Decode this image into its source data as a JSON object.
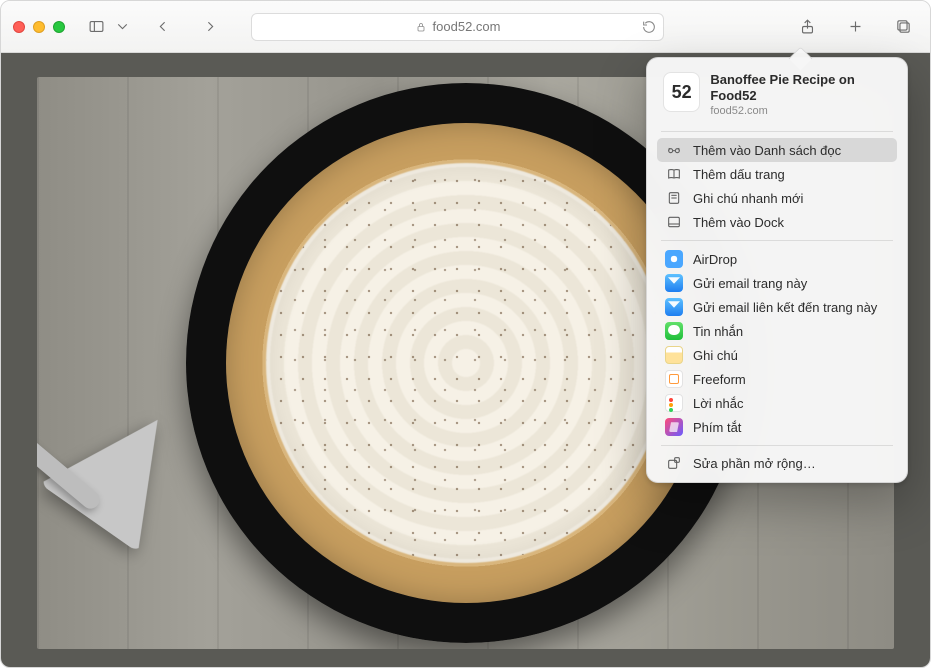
{
  "address_bar": {
    "domain": "food52.com"
  },
  "share_popover": {
    "favicon_text": "52",
    "title": "Banoffee Pie Recipe on Food52",
    "domain": "food52.com",
    "items": [
      {
        "label": "Thêm vào Danh sách đọc",
        "highlight": true
      },
      {
        "label": "Thêm dấu trang"
      },
      {
        "label": "Ghi chú nhanh mới"
      },
      {
        "label": "Thêm vào Dock"
      }
    ],
    "apps": [
      {
        "label": "AirDrop"
      },
      {
        "label": "Gửi email trang này"
      },
      {
        "label": "Gửi email liên kết đến trang này"
      },
      {
        "label": "Tin nhắn"
      },
      {
        "label": "Ghi chú"
      },
      {
        "label": "Freeform"
      },
      {
        "label": "Lời nhắc"
      },
      {
        "label": "Phím tắt"
      }
    ],
    "edit_extensions": "Sửa phần mở rộng…"
  }
}
